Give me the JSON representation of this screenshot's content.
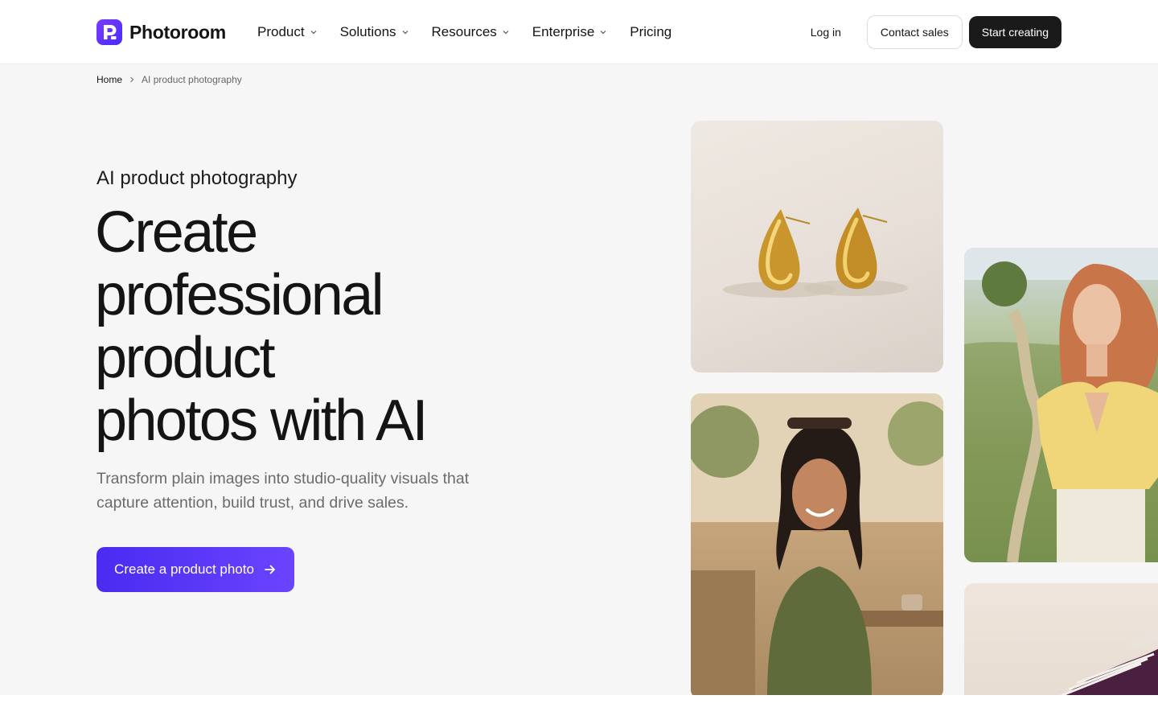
{
  "brand": {
    "name": "Photoroom",
    "accent": "#5b36ff",
    "logo_icon": "photoroom-logo-icon"
  },
  "nav": {
    "items": [
      {
        "label": "Product",
        "has_dropdown": true
      },
      {
        "label": "Solutions",
        "has_dropdown": true
      },
      {
        "label": "Resources",
        "has_dropdown": true
      },
      {
        "label": "Enterprise",
        "has_dropdown": true
      },
      {
        "label": "Pricing",
        "has_dropdown": false
      }
    ]
  },
  "header_actions": {
    "login_label": "Log in",
    "contact_label": "Contact sales",
    "start_label": "Start creating"
  },
  "breadcrumb": {
    "home": "Home",
    "separator_icon": "chevron-right-icon",
    "current": "AI product photography"
  },
  "hero": {
    "eyebrow": "AI product photography",
    "title_lines": [
      "Create",
      "professional",
      "product",
      "photos with AI"
    ],
    "subtitle": "Transform plain images into studio-quality visuals that capture attention, build trust, and drive sales.",
    "cta_label": "Create a product photo",
    "cta_icon": "arrow-right-icon"
  },
  "gallery": {
    "tiles": [
      {
        "name": "gold-earrings-photo"
      },
      {
        "name": "smiling-woman-cafe-photo"
      },
      {
        "name": "model-yellow-top-photo"
      },
      {
        "name": "purple-sneaker-photo"
      }
    ]
  }
}
